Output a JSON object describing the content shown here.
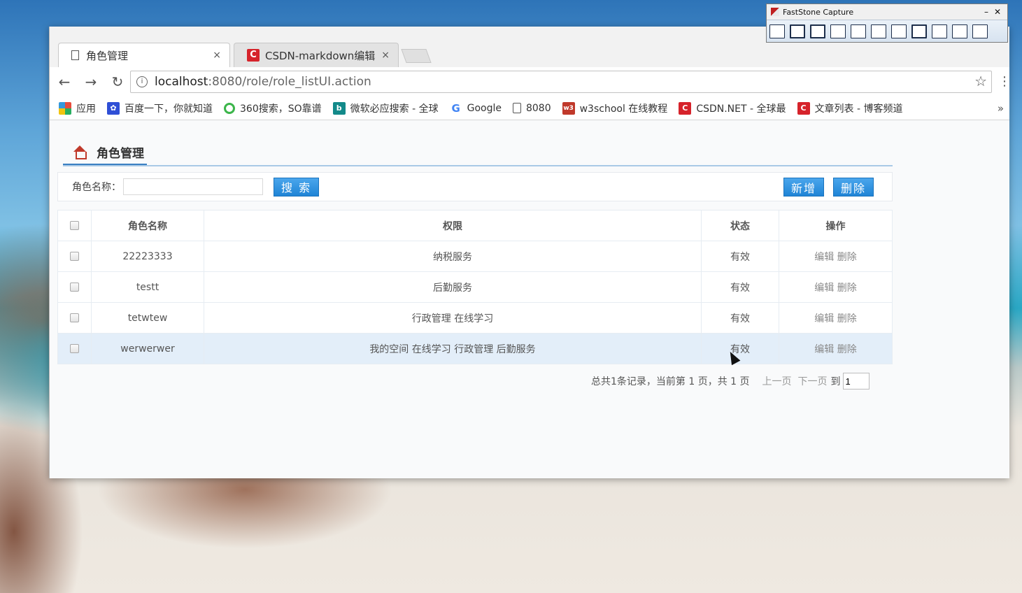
{
  "capture_tool": {
    "title": "FastStone Capture",
    "minimize": "–",
    "close": "✕"
  },
  "browser": {
    "tabs": [
      {
        "title": "角色管理",
        "close": "×"
      },
      {
        "title": "CSDN-markdown编辑器",
        "close": "×"
      }
    ],
    "nav": {
      "back": "←",
      "forward": "→",
      "reload": "↻"
    },
    "url": {
      "host": "localhost",
      "path": ":8080/role/role_listUI.action",
      "info": "i",
      "star": "☆",
      "menu": "⋮"
    },
    "bookmarks": [
      {
        "label": "应用",
        "icon": "apps-grid-icon"
      },
      {
        "label": "百度一下，你就知道",
        "icon": "baidu-paw-icon"
      },
      {
        "label": "360搜索，SO靠谱",
        "icon": "so360-icon"
      },
      {
        "label": "微软必应搜索 - 全球",
        "icon": "bing-icon"
      },
      {
        "label": "Google",
        "icon": "google-g-icon"
      },
      {
        "label": "8080",
        "icon": "page-icon"
      },
      {
        "label": "w3school 在线教程",
        "icon": "w3school-icon"
      },
      {
        "label": "CSDN.NET - 全球最",
        "icon": "csdn-icon"
      },
      {
        "label": "文章列表 - 博客频道",
        "icon": "csdn-icon"
      }
    ],
    "bookmarks_more": "»"
  },
  "page": {
    "title": "角色管理",
    "search": {
      "label": "角色名称：",
      "value": "",
      "button": "搜 索"
    },
    "actions": {
      "add": "新增",
      "delete": "删除"
    },
    "table": {
      "headers": [
        "角色名称",
        "权限",
        "状态",
        "操作"
      ],
      "rows": [
        {
          "name": "22223333",
          "perm": "纳税服务",
          "status": "有效",
          "edit": "编辑",
          "del": "删除"
        },
        {
          "name": "testt",
          "perm": "后勤服务",
          "status": "有效",
          "edit": "编辑",
          "del": "删除"
        },
        {
          "name": "tetwtew",
          "perm": "行政管理 在线学习",
          "status": "有效",
          "edit": "编辑",
          "del": "删除"
        },
        {
          "name": "werwerwer",
          "perm": "我的空间 在线学习 行政管理 后勤服务",
          "status": "有效",
          "edit": "编辑",
          "del": "删除"
        }
      ]
    },
    "pager": {
      "summary": "总共1条记录，当前第 1 页，共 1 页",
      "prev": "上一页",
      "next": "下一页",
      "goto": "到",
      "page_value": "1"
    }
  },
  "colors": {
    "accent_blue": "#1f84d6",
    "home_icon": "#c0392b",
    "highlight_row": "#e3eef9"
  }
}
